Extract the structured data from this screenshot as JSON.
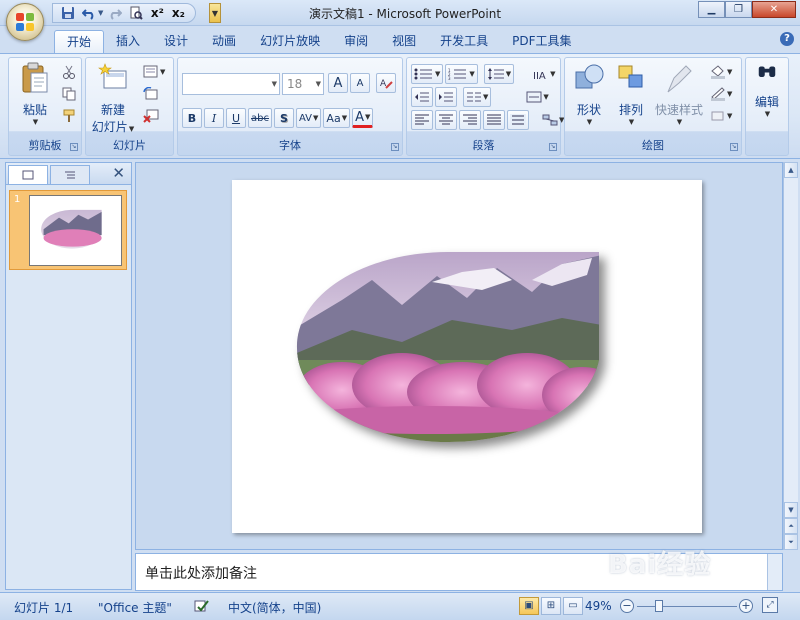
{
  "window": {
    "title": "演示文稿1 - Microsoft PowerPoint"
  },
  "quick_access": {
    "icons": [
      "save-icon",
      "undo-icon",
      "redo-icon",
      "print-preview-icon",
      "superscript-icon",
      "subscript-icon"
    ],
    "superscript_label": "x²",
    "subscript_label": "x₂"
  },
  "tabs": [
    {
      "label": "开始",
      "active": true
    },
    {
      "label": "插入"
    },
    {
      "label": "设计"
    },
    {
      "label": "动画"
    },
    {
      "label": "幻灯片放映"
    },
    {
      "label": "审阅"
    },
    {
      "label": "视图"
    },
    {
      "label": "开发工具"
    },
    {
      "label": "PDF工具集"
    }
  ],
  "ribbon": {
    "clipboard": {
      "label": "剪贴板",
      "paste_label": "粘贴"
    },
    "slides": {
      "label": "幻灯片",
      "new_slide_line1": "新建",
      "new_slide_line2": "幻灯片"
    },
    "font": {
      "label": "字体",
      "font_name": "",
      "font_size": "18",
      "bold": "B",
      "italic": "I",
      "underline": "U",
      "strike": "abc",
      "shadow": "S",
      "spacing": "AV",
      "case": "Aa",
      "color": "A",
      "grow": "A",
      "shrink": "A"
    },
    "paragraph": {
      "label": "段落"
    },
    "drawing": {
      "label": "绘图",
      "shapes_label": "形状",
      "arrange_label": "排列",
      "quick_styles_label": "快速样式"
    },
    "editing": {
      "label": "编辑"
    }
  },
  "slides_pane": {
    "thumbnail_number": "1"
  },
  "notes": {
    "placeholder": "单击此处添加备注"
  },
  "statusbar": {
    "slide_info": "幻灯片 1/1",
    "theme": "\"Office 主题\"",
    "language": "中文(简体，中国)",
    "zoom": "49%",
    "zoom_minus": "−",
    "zoom_plus": "+"
  },
  "watermark": "Bai经验"
}
